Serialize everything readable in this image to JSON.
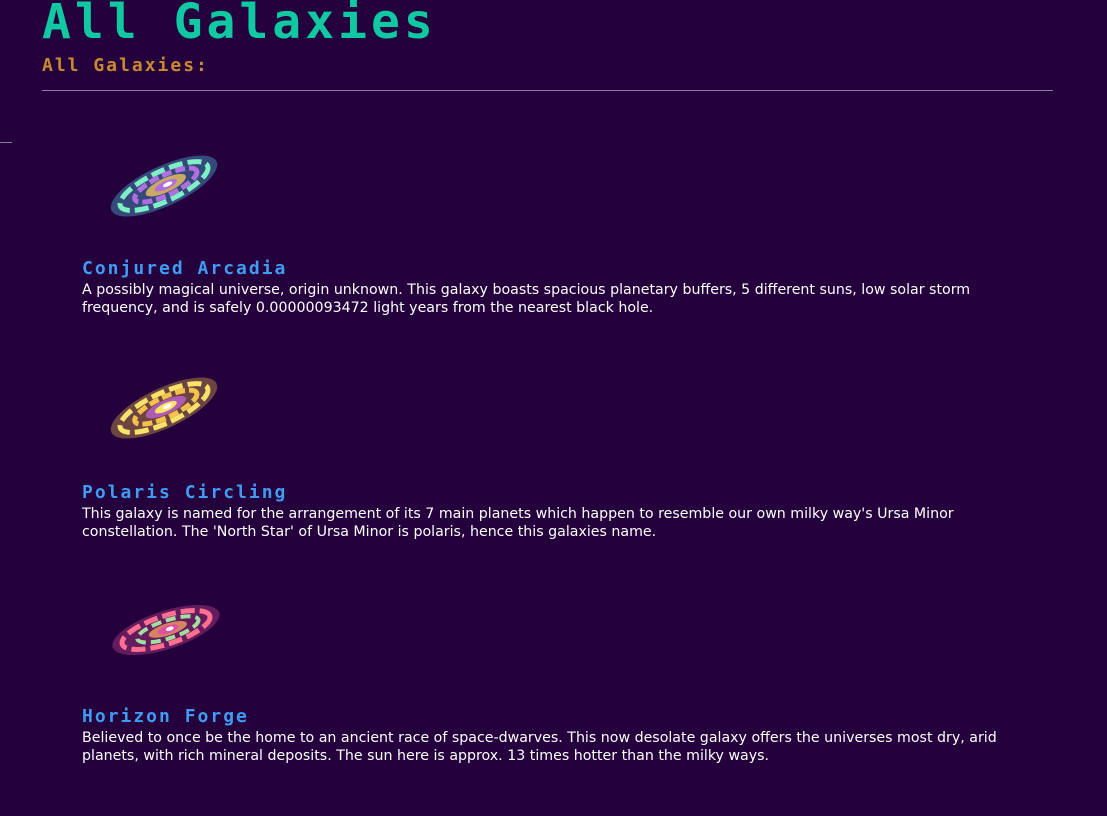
{
  "page": {
    "title": "All Galaxies",
    "subtitle": "All Galaxies:"
  },
  "galaxies": [
    {
      "name": "Conjured Arcadia",
      "description": "A possibly magical universe, origin unknown. This galaxy boasts spacious planetary buffers, 5 different suns, low solar storm frequency, and is safely 0.00000093472 light years from the nearest black hole.",
      "image_icon": "spiral-galaxy-icon",
      "colors": [
        "#7ef0c6",
        "#5ad0f0",
        "#b06fe0",
        "#f0c060"
      ]
    },
    {
      "name": "Polaris Circling",
      "description": "This galaxy is named for the arrangement of its 7 main planets which happen to resemble our own milky way's Ursa Minor constellation. The 'North Star' of Ursa Minor is polaris, hence this galaxies name.",
      "image_icon": "spiral-galaxy-icon",
      "colors": [
        "#f7e36a",
        "#f4c24a",
        "#c060d0",
        "#ffffff"
      ]
    },
    {
      "name": "Horizon Forge",
      "description": "Believed to once be the home to an ancient race of space-dwarves. This now desolate galaxy offers the universes most dry, arid planets, with rich mineral deposits. The sun here is approx. 13 times hotter than the milky ways.",
      "image_icon": "spiral-galaxy-icon",
      "colors": [
        "#ff6f8f",
        "#e050a0",
        "#9fe0a0",
        "#f0a060"
      ]
    }
  ]
}
